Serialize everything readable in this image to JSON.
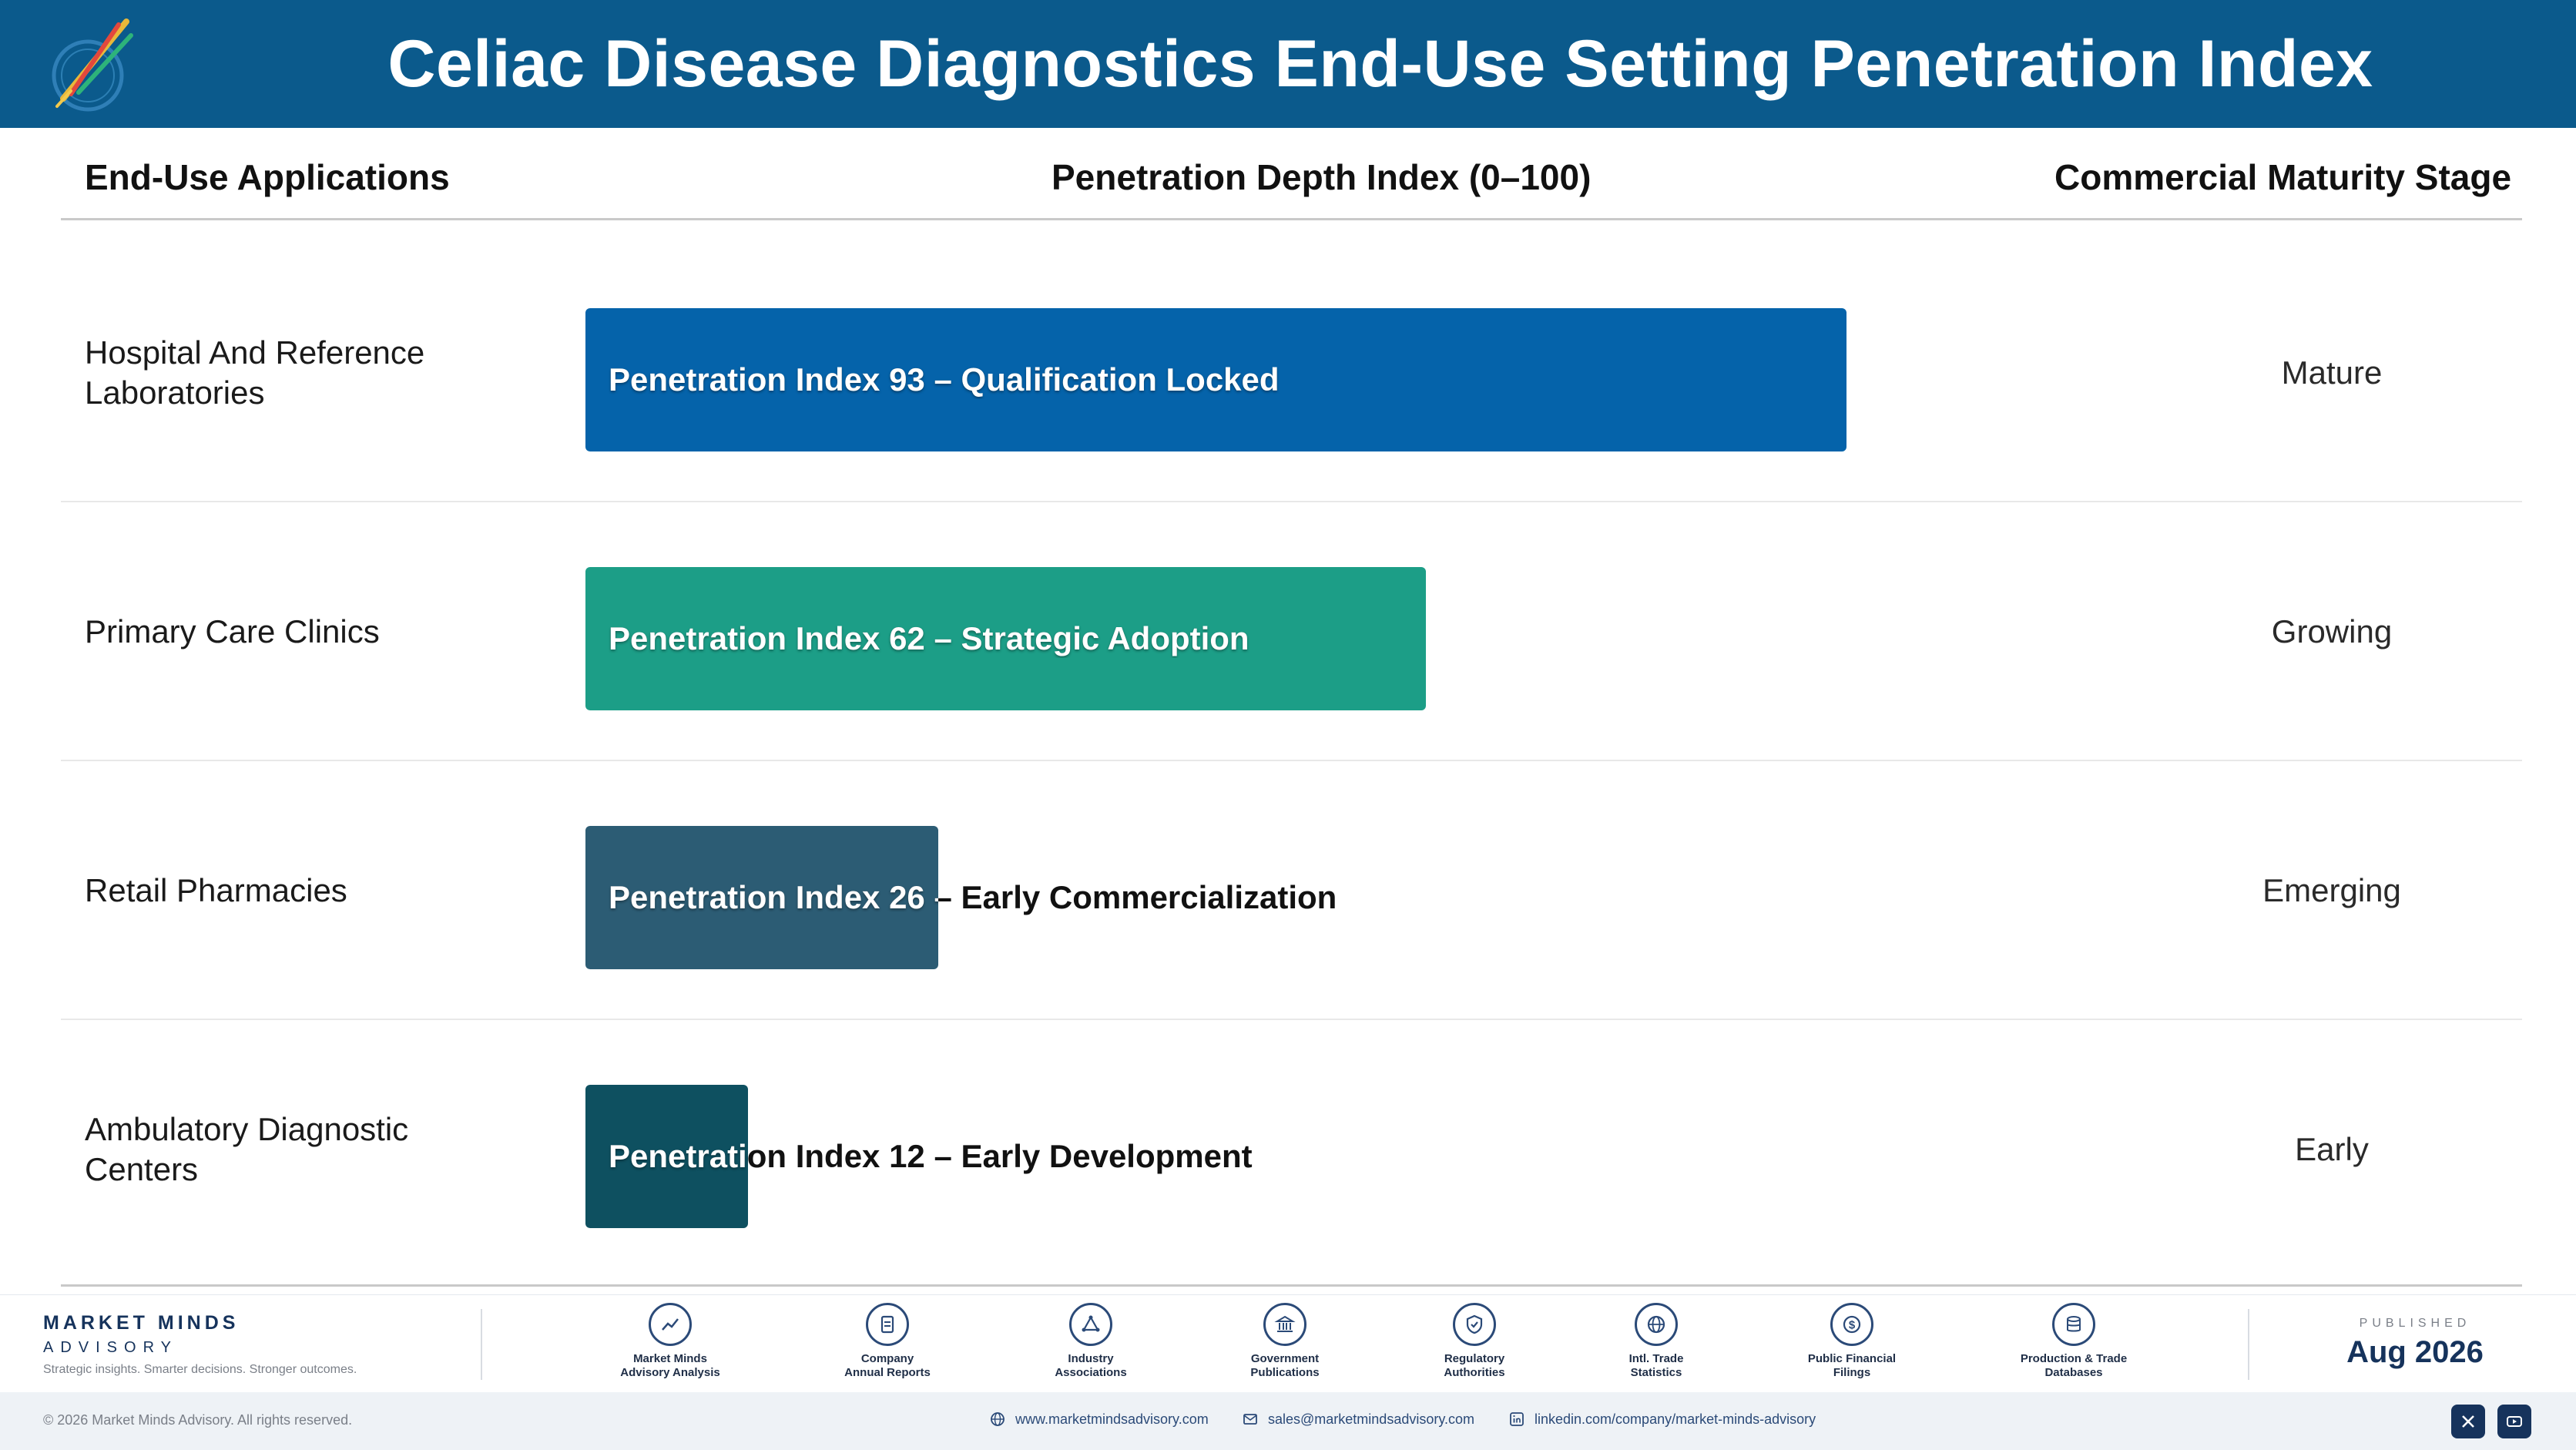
{
  "header": {
    "title": "Celiac Disease Diagnostics End-Use Setting Penetration Index"
  },
  "columns": {
    "applications": "End-Use Applications",
    "index": "Penetration Depth Index (0–100)",
    "stage": "Commercial Maturity Stage"
  },
  "chart_data": {
    "type": "bar",
    "orientation": "horizontal",
    "xlim": [
      0,
      100
    ],
    "categories": [
      "Hospital And Reference Laboratories",
      "Primary Care Clinics",
      "Retail Pharmacies",
      "Ambulatory Diagnostic Centers"
    ],
    "values": [
      93,
      62,
      26,
      12
    ],
    "bar_labels": [
      "Penetration Index 93 – Qualification Locked",
      "Penetration Index 62 – Strategic Adoption",
      "Penetration Index 26 – Early Commercialization",
      "Penetration Index 12 – Early Development"
    ],
    "stages": [
      "Mature",
      "Growing",
      "Emerging",
      "Early"
    ],
    "colors": [
      "#0563aa",
      "#1c9e87",
      "#2c5c74",
      "#0e5060"
    ],
    "grid": false
  },
  "footer": {
    "brand_name": "MARKET MINDS",
    "brand_sub": "ADVISORY",
    "tagline": "Strategic insights. Smarter decisions. Stronger outcomes.",
    "sources": [
      {
        "line1": "Market Minds",
        "line2": "Advisory Analysis",
        "icon": "trend-chart-icon"
      },
      {
        "line1": "Company",
        "line2": "Annual Reports",
        "icon": "document-icon"
      },
      {
        "line1": "Industry",
        "line2": "Associations",
        "icon": "network-icon"
      },
      {
        "line1": "Government",
        "line2": "Publications",
        "icon": "government-building-icon"
      },
      {
        "line1": "Regulatory",
        "line2": "Authorities",
        "icon": "shield-check-icon"
      },
      {
        "line1": "Intl. Trade",
        "line2": "Statistics",
        "icon": "globe-icon"
      },
      {
        "line1": "Public Financial",
        "line2": "Filings",
        "icon": "dollar-coin-icon"
      },
      {
        "line1": "Production & Trade",
        "line2": "Databases",
        "icon": "database-icon"
      }
    ],
    "published_label": "PUBLISHED",
    "published_date": "Aug 2026"
  },
  "bottom": {
    "copyright": "© 2026 Market Minds Advisory. All rights reserved.",
    "website": "www.marketmindsadvisory.com",
    "email": "sales@marketmindsadvisory.com",
    "linkedin": "linkedin.com/company/market-minds-advisory"
  }
}
